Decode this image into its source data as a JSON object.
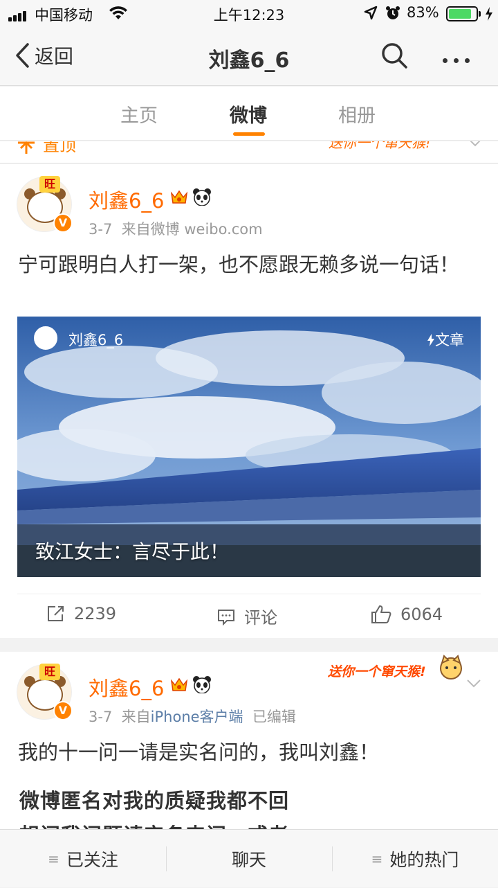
{
  "status_bar": {
    "carrier": "中国移动",
    "time": "上午12:23",
    "battery_percent": "83%",
    "battery_level": 0.83,
    "icons": [
      "signal-icon",
      "wifi-icon",
      "location-icon",
      "alarm-icon",
      "battery-icon",
      "charging-icon"
    ]
  },
  "nav": {
    "back_label": "返回",
    "title": "刘鑫6_6",
    "icons": [
      "back-chevron-icon",
      "search-icon",
      "more-icon"
    ]
  },
  "tabs": [
    {
      "label": "主页",
      "active": false
    },
    {
      "label": "微博",
      "active": true
    },
    {
      "label": "相册",
      "active": false
    }
  ],
  "accent_color": "#ff8200",
  "partial_card": {
    "pin_label": "置顶",
    "deco_text": "送你一个窜天猴!"
  },
  "posts": [
    {
      "username": "刘鑫6_6",
      "date": "3-7",
      "source_prefix": "来自",
      "source": "微博 weibo.com",
      "text": "宁可跟明白人打一架，也不愿跟无赖多说一句话！",
      "article": {
        "author": "刘鑫6_6",
        "type_label": "文章",
        "title": "致江女士：言尽于此！"
      },
      "reposts": "2239",
      "comments_label": "评论",
      "likes": "6064"
    },
    {
      "username": "刘鑫6_6",
      "date": "3-7",
      "source_prefix": "来自",
      "source": "iPhone客户端",
      "edited_label": "已编辑",
      "deco_text": "送你一个窜天猴!",
      "text": "我的十一问一请是实名问的，我叫刘鑫！",
      "bold_line1": "微博匿名对我的质疑我都不回",
      "bold_line2": "想问我问题请实名来问，或者"
    }
  ],
  "bottom_bar": [
    {
      "label": "已关注",
      "has_menu": true
    },
    {
      "label": "聊天",
      "has_menu": false
    },
    {
      "label": "她的热门",
      "has_menu": true
    }
  ]
}
